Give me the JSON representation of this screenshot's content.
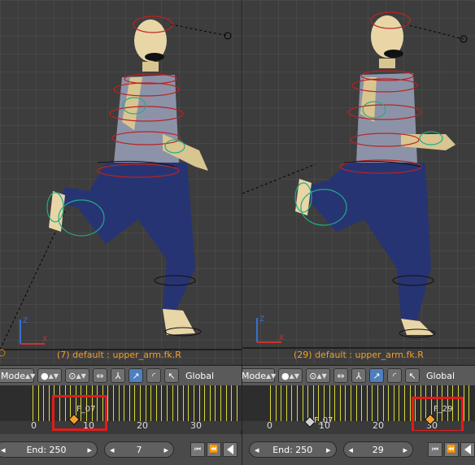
{
  "left_panel": {
    "status_text": "(7) default : upper_arm.fk.R",
    "mode_label": "Mode",
    "orientation_label": "Global",
    "keyframe_label": "F_07",
    "ticks": [
      "0",
      "10",
      "20",
      "30"
    ],
    "end_label": "End: 250",
    "current_frame": "7"
  },
  "right_panel": {
    "status_text": "(29) default : upper_arm.fk.R",
    "mode_label": "Mode",
    "orientation_label": "Global",
    "keyframe_label_1": "F_07",
    "keyframe_label_2": "F_29",
    "ticks": [
      "0",
      "10",
      "20",
      "30"
    ],
    "end_label": "End: 250",
    "current_frame": "29"
  },
  "axes": {
    "x": "X",
    "y": "Z"
  },
  "colors": {
    "status_text": "#f0a030",
    "highlight_box": "#e21b1b",
    "timeline_marker": "#d8d838",
    "active_button": "#4f7fbd"
  }
}
